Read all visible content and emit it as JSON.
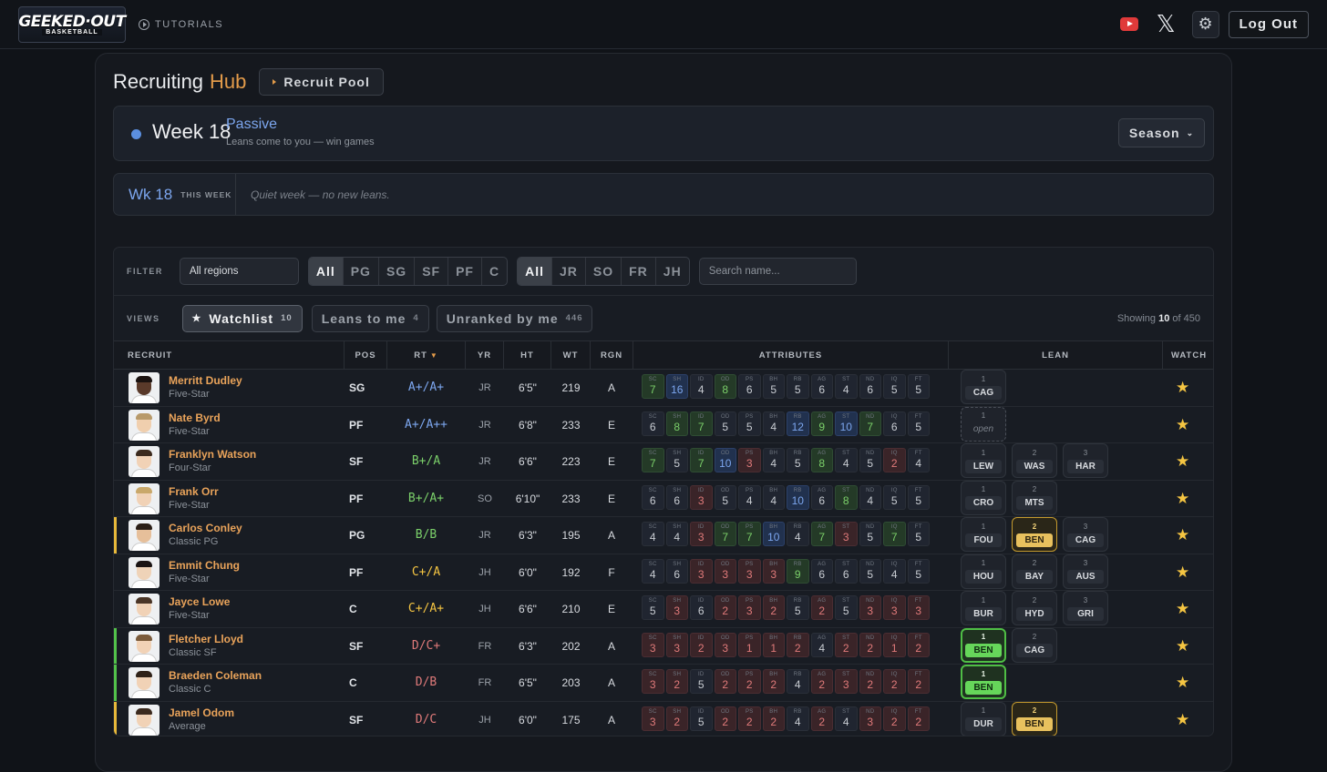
{
  "topbar": {
    "logo_text": "GEEKED·OUT",
    "logo_sub": "BASKETBALL",
    "tutorials": "TUTORIALS",
    "logout": "Log Out"
  },
  "hub": {
    "title_a": "Recruiting",
    "title_b": "Hub",
    "pool_button": "Recruit Pool"
  },
  "week": {
    "label": "Week 18",
    "mode": "Passive",
    "mode_sub": "Leans come to you — win games",
    "season_button": "Season"
  },
  "this_week": {
    "label": "Wk 18",
    "tag": "THIS WEEK",
    "message": "Quiet week — no new leans."
  },
  "filters": {
    "label": "FILTER",
    "region": "All regions",
    "positions": [
      "All",
      "PG",
      "SG",
      "SF",
      "PF",
      "C"
    ],
    "years": [
      "All",
      "JR",
      "SO",
      "FR",
      "JH"
    ],
    "search_placeholder": "Search name..."
  },
  "views": {
    "label": "VIEWS",
    "watchlist": "Watchlist",
    "watchlist_count": "10",
    "leans": "Leans to me",
    "leans_count": "4",
    "unranked": "Unranked by me",
    "unranked_count": "446",
    "showing_pre": "Showing",
    "showing_n": "10",
    "showing_post": "of 450"
  },
  "columns": {
    "recruit": "RECRUIT",
    "pos": "POS",
    "rt": "RT",
    "yr": "YR",
    "ht": "HT",
    "wt": "WT",
    "rgn": "RGN",
    "attributes": "ATTRIBUTES",
    "lean": "LEAN",
    "watch": "WATCH"
  },
  "attr_keys": [
    "SC",
    "SH",
    "ID",
    "OD",
    "PS",
    "BH",
    "RB",
    "AG",
    "ST",
    "ND",
    "IQ",
    "FT"
  ],
  "colors": {
    "accent": "#e39b4a",
    "blue": "#7ca6ee",
    "green": "#7bd06a",
    "red": "#e07a7a",
    "yellow": "#f5c542"
  },
  "recruits": [
    {
      "name": "Merritt Dudley",
      "type": "Five-Star",
      "pos": "SG",
      "rt": "A+/A+",
      "rt_color": "#7ca6ee",
      "yr": "JR",
      "ht": "6'5\"",
      "wt": "219",
      "rgn": "A",
      "skin": "#5a3a2a",
      "hair": "#1a1210",
      "mark": "",
      "attrs": [
        [
          "7",
          "g"
        ],
        [
          "16",
          "b"
        ],
        [
          "4",
          ""
        ],
        [
          "8",
          "g"
        ],
        [
          "6",
          ""
        ],
        [
          "5",
          ""
        ],
        [
          "5",
          ""
        ],
        [
          "6",
          ""
        ],
        [
          "4",
          ""
        ],
        [
          "6",
          ""
        ],
        [
          "5",
          ""
        ],
        [
          "5",
          ""
        ]
      ],
      "leans": [
        {
          "rank": "1",
          "team": "CAG",
          "style": ""
        }
      ]
    },
    {
      "name": "Nate Byrd",
      "type": "Five-Star",
      "pos": "PF",
      "rt": "A+/A++",
      "rt_color": "#7ca6ee",
      "yr": "JR",
      "ht": "6'8\"",
      "wt": "233",
      "rgn": "E",
      "skin": "#f0cfae",
      "hair": "#b89a6a",
      "mark": "",
      "attrs": [
        [
          "6",
          ""
        ],
        [
          "8",
          "g"
        ],
        [
          "7",
          "g"
        ],
        [
          "5",
          ""
        ],
        [
          "5",
          ""
        ],
        [
          "4",
          ""
        ],
        [
          "12",
          "b"
        ],
        [
          "9",
          "g"
        ],
        [
          "10",
          "b"
        ],
        [
          "7",
          "g"
        ],
        [
          "6",
          ""
        ],
        [
          "5",
          ""
        ]
      ],
      "leans": [
        {
          "rank": "1",
          "team": "open",
          "style": "open"
        }
      ]
    },
    {
      "name": "Franklyn Watson",
      "type": "Four-Star",
      "pos": "SF",
      "rt": "B+/A",
      "rt_color": "#7bd06a",
      "yr": "JR",
      "ht": "6'6\"",
      "wt": "223",
      "rgn": "E",
      "skin": "#f1d2b6",
      "hair": "#3b2a1e",
      "mark": "",
      "attrs": [
        [
          "7",
          "g"
        ],
        [
          "5",
          ""
        ],
        [
          "7",
          "g"
        ],
        [
          "10",
          "b"
        ],
        [
          "3",
          "r"
        ],
        [
          "4",
          ""
        ],
        [
          "5",
          ""
        ],
        [
          "8",
          "g"
        ],
        [
          "4",
          ""
        ],
        [
          "5",
          ""
        ],
        [
          "2",
          "r"
        ],
        [
          "4",
          ""
        ]
      ],
      "leans": [
        {
          "rank": "1",
          "team": "LEW",
          "style": ""
        },
        {
          "rank": "2",
          "team": "WAS",
          "style": ""
        },
        {
          "rank": "3",
          "team": "HAR",
          "style": ""
        }
      ]
    },
    {
      "name": "Frank Orr",
      "type": "Five-Star",
      "pos": "PF",
      "rt": "B+/A+",
      "rt_color": "#7bd06a",
      "yr": "SO",
      "ht": "6'10\"",
      "wt": "233",
      "rgn": "E",
      "skin": "#f1d2b6",
      "hair": "#c9a86a",
      "mark": "",
      "attrs": [
        [
          "6",
          ""
        ],
        [
          "6",
          ""
        ],
        [
          "3",
          "r"
        ],
        [
          "5",
          ""
        ],
        [
          "4",
          ""
        ],
        [
          "4",
          ""
        ],
        [
          "10",
          "b"
        ],
        [
          "6",
          ""
        ],
        [
          "8",
          "g"
        ],
        [
          "4",
          ""
        ],
        [
          "5",
          ""
        ],
        [
          "5",
          ""
        ]
      ],
      "leans": [
        {
          "rank": "1",
          "team": "CRO",
          "style": ""
        },
        {
          "rank": "2",
          "team": "MTS",
          "style": ""
        }
      ]
    },
    {
      "name": "Carlos Conley",
      "type": "Classic PG",
      "pos": "PG",
      "rt": "B/B",
      "rt_color": "#7bd06a",
      "yr": "JR",
      "ht": "6'3\"",
      "wt": "195",
      "rgn": "A",
      "skin": "#e6bf9a",
      "hair": "#2a1e16",
      "mark": "hl-y",
      "attrs": [
        [
          "4",
          ""
        ],
        [
          "4",
          ""
        ],
        [
          "3",
          "r"
        ],
        [
          "7",
          "g"
        ],
        [
          "7",
          "g"
        ],
        [
          "10",
          "b"
        ],
        [
          "4",
          ""
        ],
        [
          "7",
          "g"
        ],
        [
          "3",
          "r"
        ],
        [
          "5",
          ""
        ],
        [
          "7",
          "g"
        ],
        [
          "5",
          ""
        ]
      ],
      "leans": [
        {
          "rank": "1",
          "team": "FOU",
          "style": ""
        },
        {
          "rank": "2",
          "team": "BEN",
          "style": "y"
        },
        {
          "rank": "3",
          "team": "CAG",
          "style": ""
        }
      ]
    },
    {
      "name": "Emmit Chung",
      "type": "Five-Star",
      "pos": "PF",
      "rt": "C+/A",
      "rt_color": "#f5c542",
      "yr": "JH",
      "ht": "6'0\"",
      "wt": "192",
      "rgn": "F",
      "skin": "#efd3b8",
      "hair": "#1a1414",
      "mark": "",
      "attrs": [
        [
          "4",
          ""
        ],
        [
          "6",
          ""
        ],
        [
          "3",
          "r"
        ],
        [
          "3",
          "r"
        ],
        [
          "3",
          "r"
        ],
        [
          "3",
          "r"
        ],
        [
          "9",
          "g"
        ],
        [
          "6",
          ""
        ],
        [
          "6",
          ""
        ],
        [
          "5",
          ""
        ],
        [
          "4",
          ""
        ],
        [
          "5",
          ""
        ]
      ],
      "leans": [
        {
          "rank": "1",
          "team": "HOU",
          "style": ""
        },
        {
          "rank": "2",
          "team": "BAY",
          "style": ""
        },
        {
          "rank": "3",
          "team": "AUS",
          "style": ""
        }
      ]
    },
    {
      "name": "Jayce Lowe",
      "type": "Five-Star",
      "pos": "C",
      "rt": "C+/A+",
      "rt_color": "#f5c542",
      "yr": "JH",
      "ht": "6'6\"",
      "wt": "210",
      "rgn": "E",
      "skin": "#f1d2b6",
      "hair": "#4a3526",
      "mark": "",
      "attrs": [
        [
          "5",
          ""
        ],
        [
          "3",
          "r"
        ],
        [
          "6",
          ""
        ],
        [
          "2",
          "r"
        ],
        [
          "3",
          "r"
        ],
        [
          "2",
          "r"
        ],
        [
          "5",
          ""
        ],
        [
          "2",
          "r"
        ],
        [
          "5",
          ""
        ],
        [
          "3",
          "r"
        ],
        [
          "3",
          "r"
        ],
        [
          "3",
          "r"
        ]
      ],
      "leans": [
        {
          "rank": "1",
          "team": "BUR",
          "style": ""
        },
        {
          "rank": "2",
          "team": "HYD",
          "style": ""
        },
        {
          "rank": "3",
          "team": "GRI",
          "style": ""
        }
      ]
    },
    {
      "name": "Fletcher Lloyd",
      "type": "Classic SF",
      "pos": "SF",
      "rt": "D/C+",
      "rt_color": "#e07a7a",
      "yr": "FR",
      "ht": "6'3\"",
      "wt": "202",
      "rgn": "A",
      "skin": "#f1d2b6",
      "hair": "#7a5a3a",
      "mark": "hl-g",
      "attrs": [
        [
          "3",
          "r"
        ],
        [
          "3",
          "r"
        ],
        [
          "2",
          "r"
        ],
        [
          "3",
          "r"
        ],
        [
          "1",
          "r"
        ],
        [
          "1",
          "r"
        ],
        [
          "2",
          "r"
        ],
        [
          "4",
          ""
        ],
        [
          "2",
          "r"
        ],
        [
          "2",
          "r"
        ],
        [
          "1",
          "r"
        ],
        [
          "2",
          "r"
        ]
      ],
      "leans": [
        {
          "rank": "1",
          "team": "BEN",
          "style": "gr"
        },
        {
          "rank": "2",
          "team": "CAG",
          "style": ""
        }
      ]
    },
    {
      "name": "Braeden Coleman",
      "type": "Classic C",
      "pos": "C",
      "rt": "D/B",
      "rt_color": "#e07a7a",
      "yr": "FR",
      "ht": "6'5\"",
      "wt": "203",
      "rgn": "A",
      "skin": "#f1d2b6",
      "hair": "#2f2219",
      "mark": "hl-g",
      "attrs": [
        [
          "3",
          "r"
        ],
        [
          "2",
          "r"
        ],
        [
          "5",
          ""
        ],
        [
          "2",
          "r"
        ],
        [
          "2",
          "r"
        ],
        [
          "2",
          "r"
        ],
        [
          "4",
          ""
        ],
        [
          "2",
          "r"
        ],
        [
          "3",
          "r"
        ],
        [
          "2",
          "r"
        ],
        [
          "2",
          "r"
        ],
        [
          "2",
          "r"
        ]
      ],
      "leans": [
        {
          "rank": "1",
          "team": "BEN",
          "style": "gr"
        }
      ]
    },
    {
      "name": "Jamel Odom",
      "type": "Average",
      "pos": "SF",
      "rt": "D/C",
      "rt_color": "#e07a7a",
      "yr": "JH",
      "ht": "6'0\"",
      "wt": "175",
      "rgn": "A",
      "skin": "#f1d2b6",
      "hair": "#3b2a1e",
      "mark": "hl-y",
      "attrs": [
        [
          "3",
          "r"
        ],
        [
          "2",
          "r"
        ],
        [
          "5",
          ""
        ],
        [
          "2",
          "r"
        ],
        [
          "2",
          "r"
        ],
        [
          "2",
          "r"
        ],
        [
          "4",
          ""
        ],
        [
          "2",
          "r"
        ],
        [
          "4",
          ""
        ],
        [
          "3",
          "r"
        ],
        [
          "2",
          "r"
        ],
        [
          "2",
          "r"
        ]
      ],
      "leans": [
        {
          "rank": "1",
          "team": "DUR",
          "style": ""
        },
        {
          "rank": "2",
          "team": "BEN",
          "style": "y"
        }
      ]
    }
  ]
}
